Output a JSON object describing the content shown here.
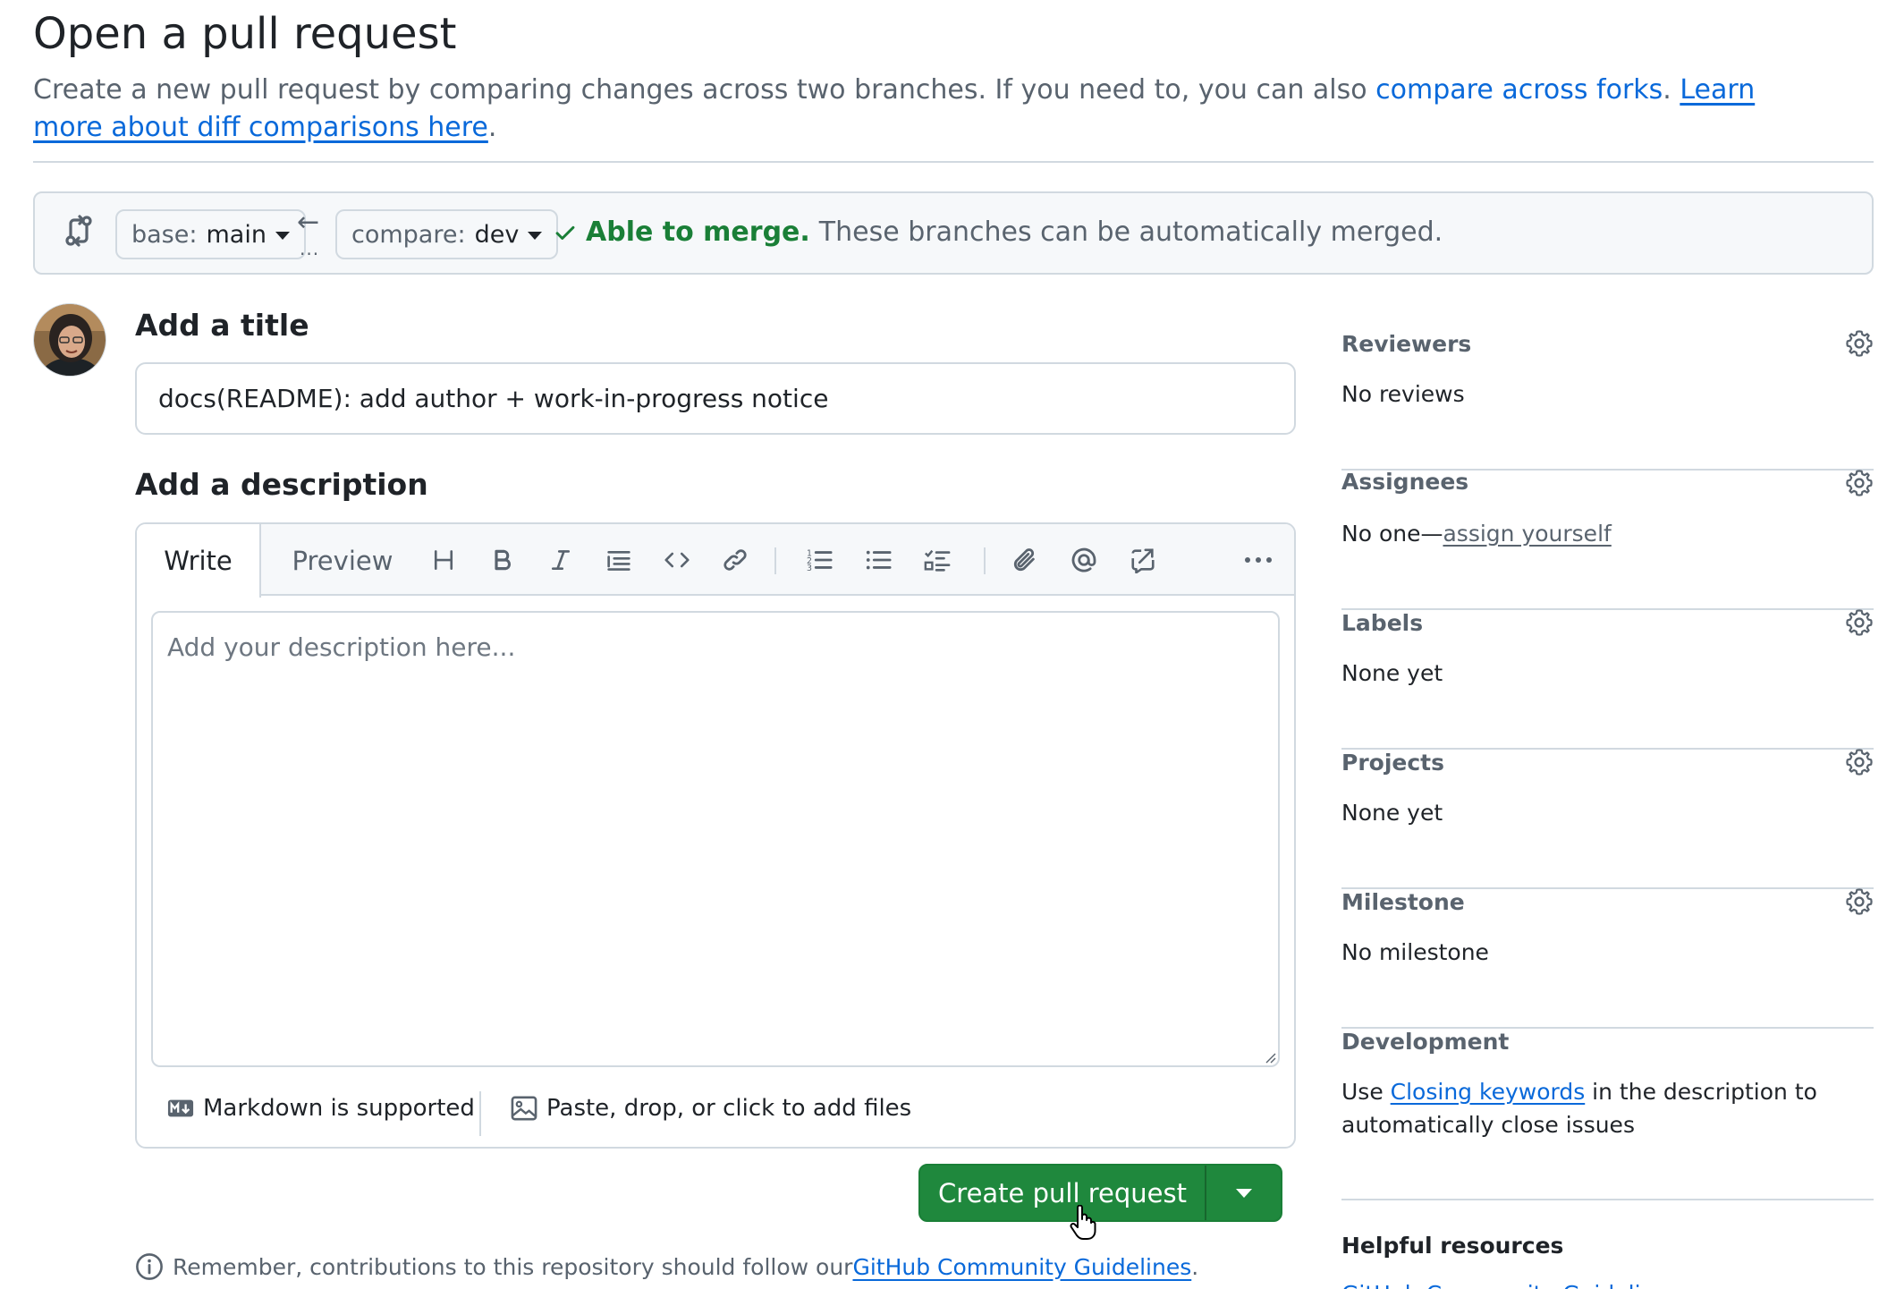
{
  "page": {
    "title": "Open a pull request",
    "intro_text": "Create a new pull request by comparing changes across two branches. If you need to, you can also ",
    "compare_forks_link": "compare across forks",
    "sep": ". ",
    "learn_more_link": "Learn more about diff comparisons here",
    "end": "."
  },
  "range": {
    "base_key": "base:",
    "base_value": "main",
    "compare_key": "compare:",
    "compare_value": "dev",
    "arrow": "←",
    "dots": "...",
    "merge_ok": "Able to merge.",
    "merge_msg": "These branches can be automatically merged."
  },
  "form": {
    "title_heading": "Add a title",
    "title_value": "docs(README): add author + work-in-progress notice",
    "description_heading": "Add a description",
    "tabs": {
      "write": "Write",
      "preview": "Preview"
    },
    "toolbar_icons": [
      "heading-icon",
      "bold-icon",
      "italic-icon",
      "quote-icon",
      "code-icon",
      "link-icon",
      "ordered-list-icon",
      "unordered-list-icon",
      "task-list-icon",
      "attach-icon",
      "mention-icon",
      "reference-icon",
      "more-icon"
    ],
    "description_placeholder": "Add your description here...",
    "markdown_note": "Markdown is supported",
    "files_note": "Paste, drop, or click to add files",
    "submit_label": "Create pull request",
    "remember_text": "Remember, contributions to this repository should follow our ",
    "remember_link": "GitHub Community Guidelines",
    "remember_end": "."
  },
  "sidebar": {
    "reviewers": {
      "label": "Reviewers",
      "value": "No reviews"
    },
    "assignees": {
      "label": "Assignees",
      "value_prefix": "No one—",
      "value_link": "assign yourself"
    },
    "labels": {
      "label": "Labels",
      "value": "None yet"
    },
    "projects": {
      "label": "Projects",
      "value": "None yet"
    },
    "milestone": {
      "label": "Milestone",
      "value": "No milestone"
    },
    "development": {
      "label": "Development",
      "prefix": "Use ",
      "link": "Closing keywords",
      "suffix": " in the description to",
      "line2": "automatically close issues"
    },
    "helpful": {
      "label": "Helpful resources",
      "link": "GitHub Community Guidelines"
    }
  },
  "colors": {
    "accent_blue": "#0969da",
    "success_green": "#1a7f37",
    "button_green": "#1f883d",
    "muted_text": "#59636e",
    "border": "#d1d9e0"
  }
}
